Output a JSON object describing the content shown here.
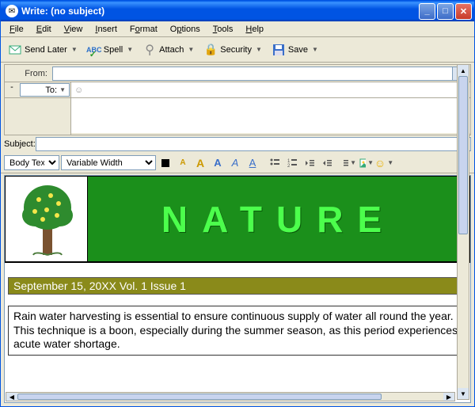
{
  "window": {
    "title": "Write: (no subject)"
  },
  "menu": {
    "file": "File",
    "edit": "Edit",
    "view": "View",
    "insert": "Insert",
    "format": "Format",
    "options": "Options",
    "tools": "Tools",
    "help": "Help"
  },
  "toolbar": {
    "send_later": "Send Later",
    "spell": "Spell",
    "attach": "Attach",
    "security": "Security",
    "save": "Save"
  },
  "addr": {
    "from": "From:",
    "to": "To:",
    "subject": "Subject:"
  },
  "format_bar": {
    "paragraph": "Body Text",
    "font": "Variable Width"
  },
  "newsletter": {
    "title": "NATURE",
    "issue_info": "September 15, 20XX Vol. 1 Issue 1",
    "body_text": "Rain water harvesting is essential to ensure continuous supply of water all round the year.  This technique is a boon, especially during the summer season, as this period experiences acute water shortage."
  },
  "icons": {
    "send": "✉",
    "spell": "ABC",
    "attach": "📎",
    "security": "🔒",
    "save": "💾",
    "contact": "👤",
    "smiley": "☺"
  }
}
